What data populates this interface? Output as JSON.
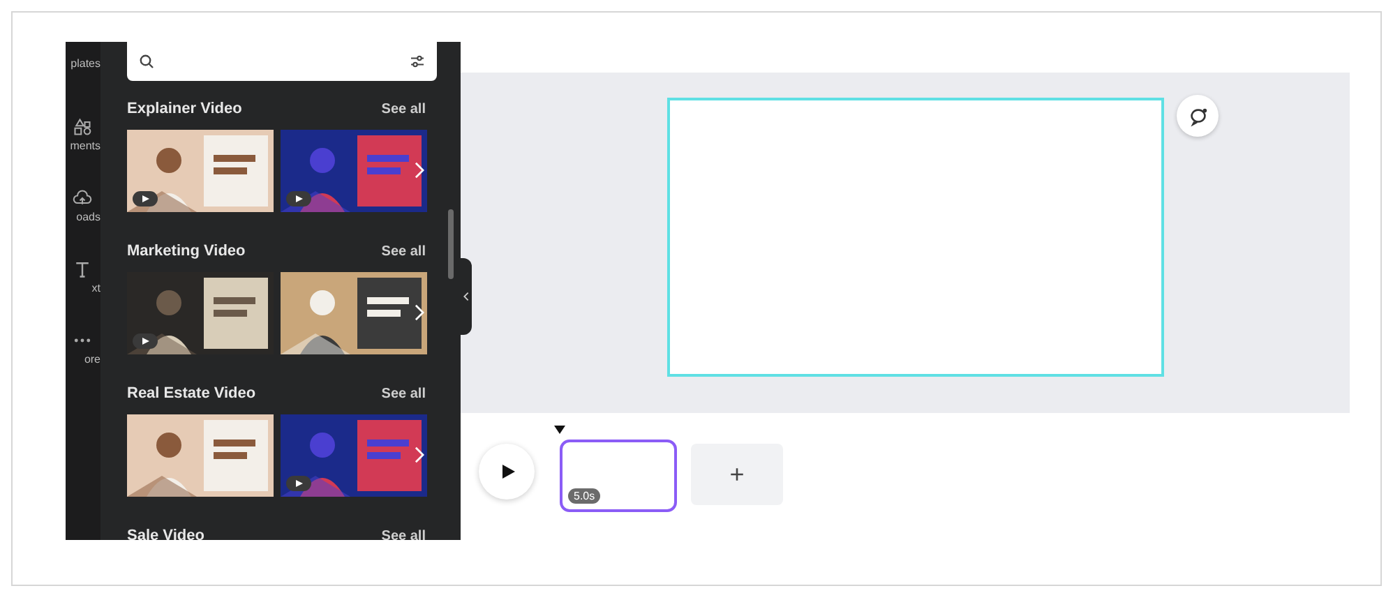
{
  "sidebar": {
    "items": [
      {
        "label": "plates"
      },
      {
        "label": "ments"
      },
      {
        "label": "oads"
      },
      {
        "label": "xt"
      },
      {
        "label": "ore"
      }
    ]
  },
  "sections": [
    {
      "title": "Explainer Video",
      "see_all": "See all",
      "thumbnails": [
        {
          "kind": "picture",
          "play_badge": true
        },
        {
          "kind": "picture",
          "play_badge": true
        }
      ]
    },
    {
      "title": "Marketing Video",
      "see_all": "See all",
      "thumbnails": [
        {
          "kind": "picture",
          "play_badge": true
        },
        {
          "kind": "picture",
          "play_badge": false
        }
      ]
    },
    {
      "title": "Real Estate Video",
      "see_all": "See all",
      "thumbnails": [
        {
          "kind": "picture",
          "play_badge": false
        },
        {
          "kind": "picture",
          "play_badge": true
        }
      ]
    },
    {
      "title": "Sale Video",
      "see_all": "See all"
    }
  ],
  "timeline": {
    "clips": [
      {
        "duration": "5.0s",
        "selected": true
      }
    ],
    "add_button": "+"
  }
}
